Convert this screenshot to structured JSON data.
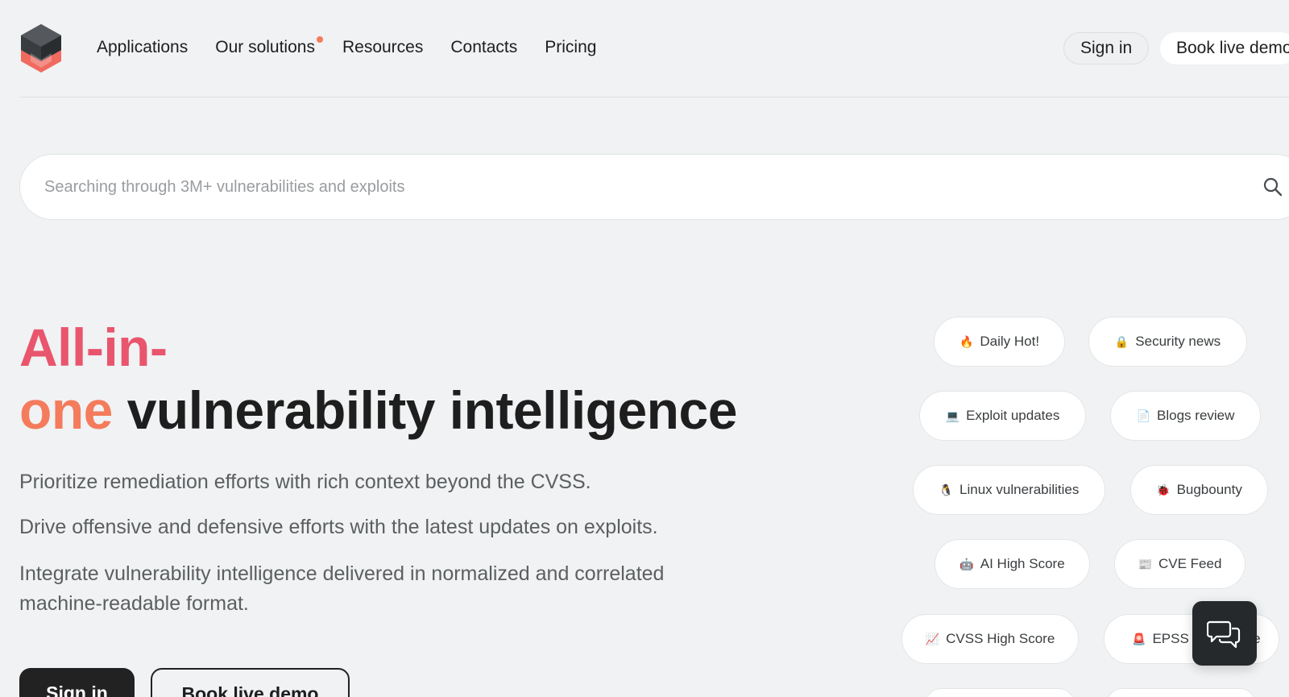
{
  "nav": {
    "items": [
      {
        "label": "Applications"
      },
      {
        "label": "Our solutions"
      },
      {
        "label": "Resources"
      },
      {
        "label": "Contacts"
      },
      {
        "label": "Pricing"
      }
    ],
    "sign_in": "Sign in",
    "book_demo": "Book live demo"
  },
  "search": {
    "placeholder": "Searching through 3M+ vulnerabilities and exploits",
    "value": ""
  },
  "hero": {
    "title_part1": "All-in-",
    "title_part2": "one",
    "title_part3": "vulnerability intelligence",
    "p1": "Prioritize remediation efforts with rich context beyond the CVSS.",
    "p2": "Drive offensive and defensive efforts with the latest updates on exploits.",
    "p3": "Integrate vulnerability intelligence delivered in normalized and correlated machine-readable format.",
    "sign_in": "Sign in",
    "book_demo": "Book live demo"
  },
  "tags": [
    {
      "emoji": "🔥",
      "label": "Daily Hot!"
    },
    {
      "emoji": "🔒",
      "label": "Security news"
    },
    {
      "emoji": "💻",
      "label": "Exploit updates"
    },
    {
      "emoji": "📄",
      "label": "Blogs review"
    },
    {
      "emoji": "🐧",
      "label": "Linux vulnerabilities"
    },
    {
      "emoji": "🐞",
      "label": "Bugbounty"
    },
    {
      "emoji": "🤖",
      "label": "AI High Score"
    },
    {
      "emoji": "📰",
      "label": "CVE Feed"
    },
    {
      "emoji": "📈",
      "label": "CVSS High Score"
    },
    {
      "emoji": "🚨",
      "label": "EPSS High Score"
    }
  ],
  "colors": {
    "brand_pink": "#e9556d",
    "brand_orange": "#f47b5c",
    "dark": "#1e1e1e",
    "background": "#f0f2f3"
  }
}
